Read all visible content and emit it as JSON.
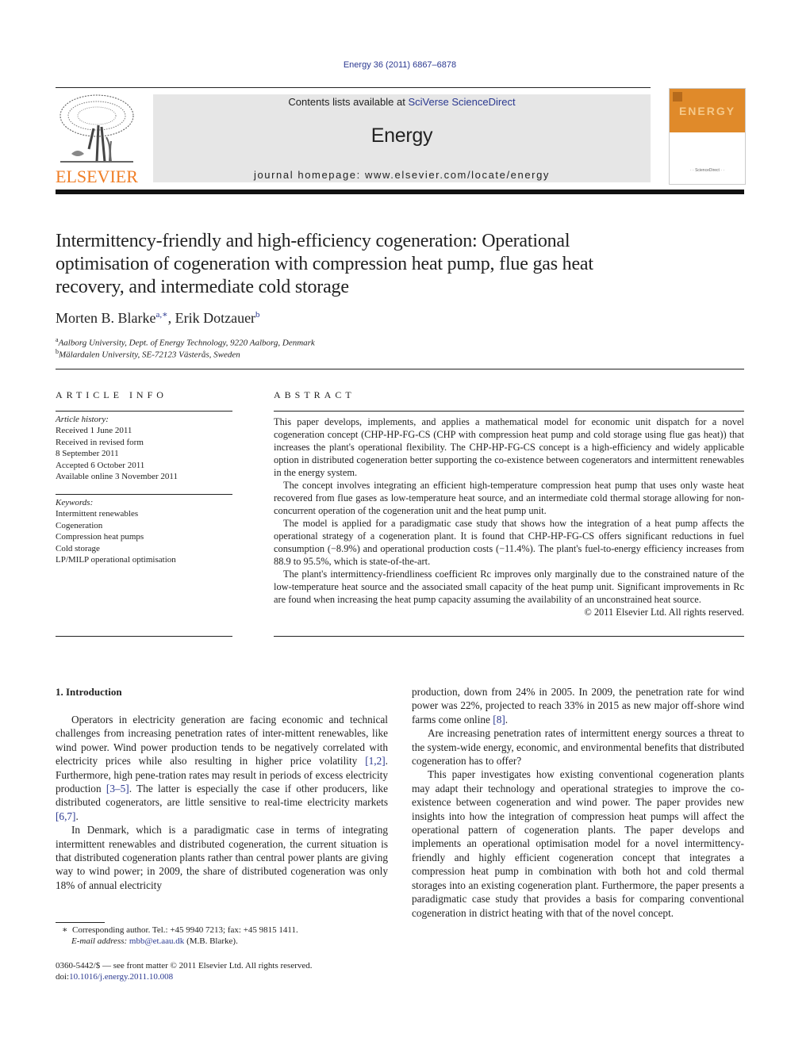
{
  "header": {
    "citation": "Energy 36 (2011) 6867–6878",
    "contents_prefix": "Contents lists available at ",
    "contents_link": "SciVerse ScienceDirect",
    "journal_title": "Energy",
    "homepage": "journal homepage: www.elsevier.com/locate/energy",
    "publisher_logo": "ELSEVIER",
    "cover_title": "ENERGY",
    "brand_color": "#f07e26",
    "link_color": "#2b3990"
  },
  "article": {
    "title": "Intermittency-friendly and high-efficiency cogeneration: Operational optimisation of cogeneration with compression heat pump, flue gas heat recovery, and intermediate cold storage",
    "authors": [
      {
        "name": "Morten B. Blarke",
        "marks": "a,∗"
      },
      {
        "name": "Erik Dotzauer",
        "marks": "b"
      }
    ],
    "author_separator": ", ",
    "affiliations": [
      {
        "mark": "a",
        "text": "Aalborg University, Dept. of Energy Technology, 9220 Aalborg, Denmark"
      },
      {
        "mark": "b",
        "text": "Mälardalen University, SE-72123 Västerås, Sweden"
      }
    ]
  },
  "article_info": {
    "heading": "ARTICLE INFO",
    "history_label": "Article history:",
    "history": [
      "Received 1 June 2011",
      "Received in revised form",
      "8 September 2011",
      "Accepted 6 October 2011",
      "Available online 3 November 2011"
    ],
    "keywords_label": "Keywords:",
    "keywords": [
      "Intermittent renewables",
      "Cogeneration",
      "Compression heat pumps",
      "Cold storage",
      "LP/MILP operational optimisation"
    ]
  },
  "abstract": {
    "heading": "ABSTRACT",
    "paragraphs": [
      "This paper develops, implements, and applies a mathematical model for economic unit dispatch for a novel cogeneration concept (CHP-HP-FG-CS (CHP with compression heat pump and cold storage using flue gas heat)) that increases the plant's operational flexibility. The CHP-HP-FG-CS concept is a high-efficiency and widely applicable option in distributed cogeneration better supporting the co-existence between cogenerators and intermittent renewables in the energy system.",
      "The concept involves integrating an efficient high-temperature compression heat pump that uses only waste heat recovered from flue gases as low-temperature heat source, and an intermediate cold thermal storage allowing for non-concurrent operation of the cogeneration unit and the heat pump unit.",
      "The model is applied for a paradigmatic case study that shows how the integration of a heat pump affects the operational strategy of a cogeneration plant. It is found that CHP-HP-FG-CS offers significant reductions in fuel consumption (−8.9%) and operational production costs (−11.4%). The plant's fuel-to-energy efficiency increases from 88.9 to 95.5%, which is state-of-the-art.",
      "The plant's intermittency-friendliness coefficient Rc improves only marginally due to the constrained nature of the low-temperature heat source and the associated small capacity of the heat pump unit. Significant improvements in Rc are found when increasing the heat pump capacity assuming the availability of an unconstrained heat source."
    ],
    "copyright": "© 2011 Elsevier Ltd. All rights reserved."
  },
  "introduction": {
    "heading": "1.  Introduction",
    "left_column": [
      {
        "indent": true,
        "parts": [
          {
            "t": "Operators in electricity generation are facing economic and technical challenges from increasing penetration rates of inter-mittent renewables, like wind power. Wind power production tends to be negatively correlated with electricity prices while also resulting in higher price volatility "
          },
          {
            "t": "[1,2]",
            "link": true
          },
          {
            "t": ". Furthermore, high pene-tration rates may result in periods of excess electricity production "
          },
          {
            "t": "[3–5]",
            "link": true
          },
          {
            "t": ". The latter is especially the case if other producers, like distributed cogenerators, are little sensitive to real-time electricity markets "
          },
          {
            "t": "[6,7]",
            "link": true
          },
          {
            "t": "."
          }
        ]
      },
      {
        "indent": true,
        "parts": [
          {
            "t": "In Denmark, which is a paradigmatic case in terms of integrating intermittent renewables and distributed cogeneration, the current situation is that distributed cogeneration plants rather than central power plants are giving way to wind power; in 2009, the share of distributed cogeneration was only 18% of annual electricity"
          }
        ]
      }
    ],
    "right_column": [
      {
        "indent": false,
        "parts": [
          {
            "t": "production, down from 24% in 2005. In 2009, the penetration rate for wind power was 22%, projected to reach 33% in 2015 as new major off-shore wind farms come online "
          },
          {
            "t": "[8]",
            "link": true
          },
          {
            "t": "."
          }
        ]
      },
      {
        "indent": true,
        "parts": [
          {
            "t": "Are increasing penetration rates of intermittent energy sources a threat to the system-wide energy, economic, and environmental benefits that distributed cogeneration has to offer?"
          }
        ]
      },
      {
        "indent": true,
        "parts": [
          {
            "t": "This paper investigates how existing conventional cogeneration plants may adapt their technology and operational strategies to improve the co-existence between cogeneration and wind power. The paper provides new insights into how the integration of compression heat pumps will affect the operational pattern of cogeneration plants. The paper develops and implements an operational optimisation model for a novel intermittency-friendly and highly efficient cogeneration concept that integrates a compression heat pump in combination with both hot and cold thermal storages into an existing cogeneration plant. Furthermore, the paper presents a paradigmatic case study that provides a basis for comparing conventional cogeneration in district heating with that of the novel concept."
          }
        ]
      }
    ]
  },
  "footnotes": {
    "corresponding_mark": "∗",
    "corresponding": "Corresponding author. Tel.: +45 9940 7213; fax: +45 9815 1411.",
    "email_label": "E-mail address: ",
    "email": "mbb@et.aau.dk",
    "email_suffix": " (M.B. Blarke).",
    "issn_line": "0360-5442/$ — see front matter © 2011 Elsevier Ltd. All rights reserved.",
    "doi_label": "doi:",
    "doi": "10.1016/j.energy.2011.10.008"
  }
}
